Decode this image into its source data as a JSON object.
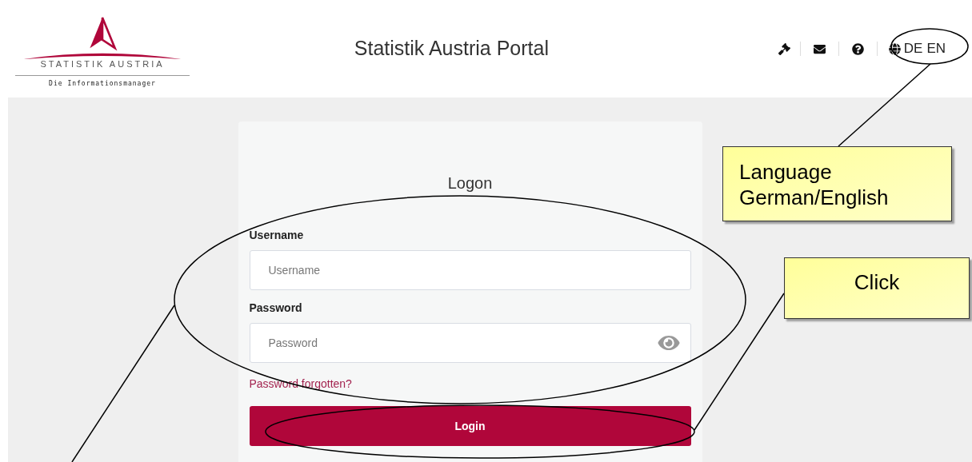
{
  "header": {
    "logo": {
      "name": "STATISTIK AUSTRIA",
      "tagline": "Die Informationsmanager"
    },
    "title": "Statistik Austria Portal",
    "languages": [
      "DE",
      "EN"
    ]
  },
  "login_form": {
    "title": "Logon",
    "fields": [
      {
        "label": "Username",
        "placeholder": "Username",
        "kind": "text"
      },
      {
        "label": "Password",
        "placeholder": "Password",
        "kind": "password"
      }
    ],
    "forgot_link": "Password forgotten?",
    "submit": "Login"
  },
  "callouts": [
    {
      "text": "Language German/English"
    },
    {
      "text": "Click"
    }
  ]
}
